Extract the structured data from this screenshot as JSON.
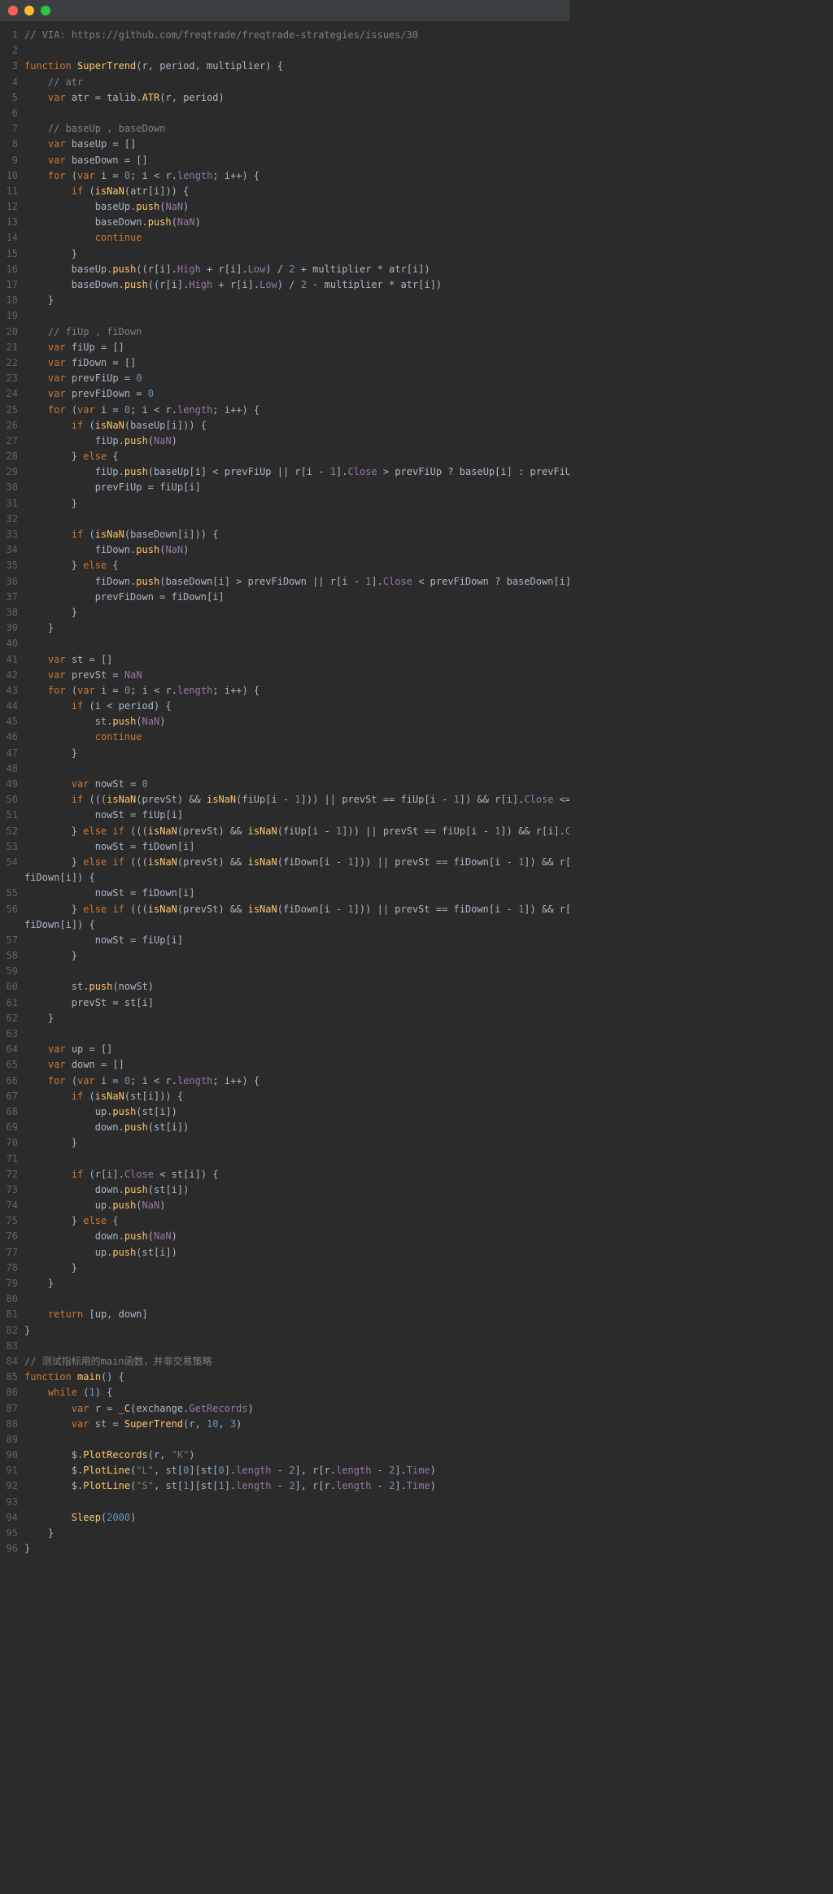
{
  "window": {
    "traffic_lights": [
      "close",
      "minimize",
      "zoom"
    ]
  },
  "gutter": {
    "start": 1,
    "end": 96
  },
  "tokens": {
    "comment_via": "// VIA: https://github.com/freqtrade/freqtrade-strategies/issues/30",
    "function": "function",
    "SuperTrend": "SuperTrend",
    "main": "main",
    "var": "var",
    "for": "for",
    "if": "if",
    "else": "else",
    "continue": "continue",
    "return": "return",
    "while": "while",
    "NaN": "NaN",
    "comment_atr": "// atr",
    "comment_base": "// baseUp , baseDown",
    "comment_fi": "// fiUp , fiDown",
    "comment_main": "// 测试指标用的main函数，并非交易策略",
    "atr": "atr",
    "talib": "talib",
    "ATR": "ATR",
    "r": "r",
    "period": "period",
    "multiplier": "multiplier",
    "baseUp": "baseUp",
    "baseDown": "baseDown",
    "i": "i",
    "length": "length",
    "isNaN": "isNaN",
    "push": "push",
    "High": "High",
    "Low": "Low",
    "Close": "Close",
    "Time": "Time",
    "fiUp": "fiUp",
    "fiDown": "fiDown",
    "prevFiUp": "prevFiUp",
    "prevFiDown": "prevFiDown",
    "st": "st",
    "prevSt": "prevSt",
    "nowSt": "nowSt",
    "up": "up",
    "down": "down",
    "exchange": "exchange",
    "GetRecords": "GetRecords",
    "PlotRecords": "PlotRecords",
    "PlotLine": "PlotLine",
    "Sleep": "Sleep",
    "_C": "_C",
    "dollar": "$",
    "K": "\"K\"",
    "L": "\"L\"",
    "S": "\"S\"",
    "n0": "0",
    "n1": "1",
    "n2": "2",
    "n3": "3",
    "n10": "10",
    "n2000": "2000"
  }
}
